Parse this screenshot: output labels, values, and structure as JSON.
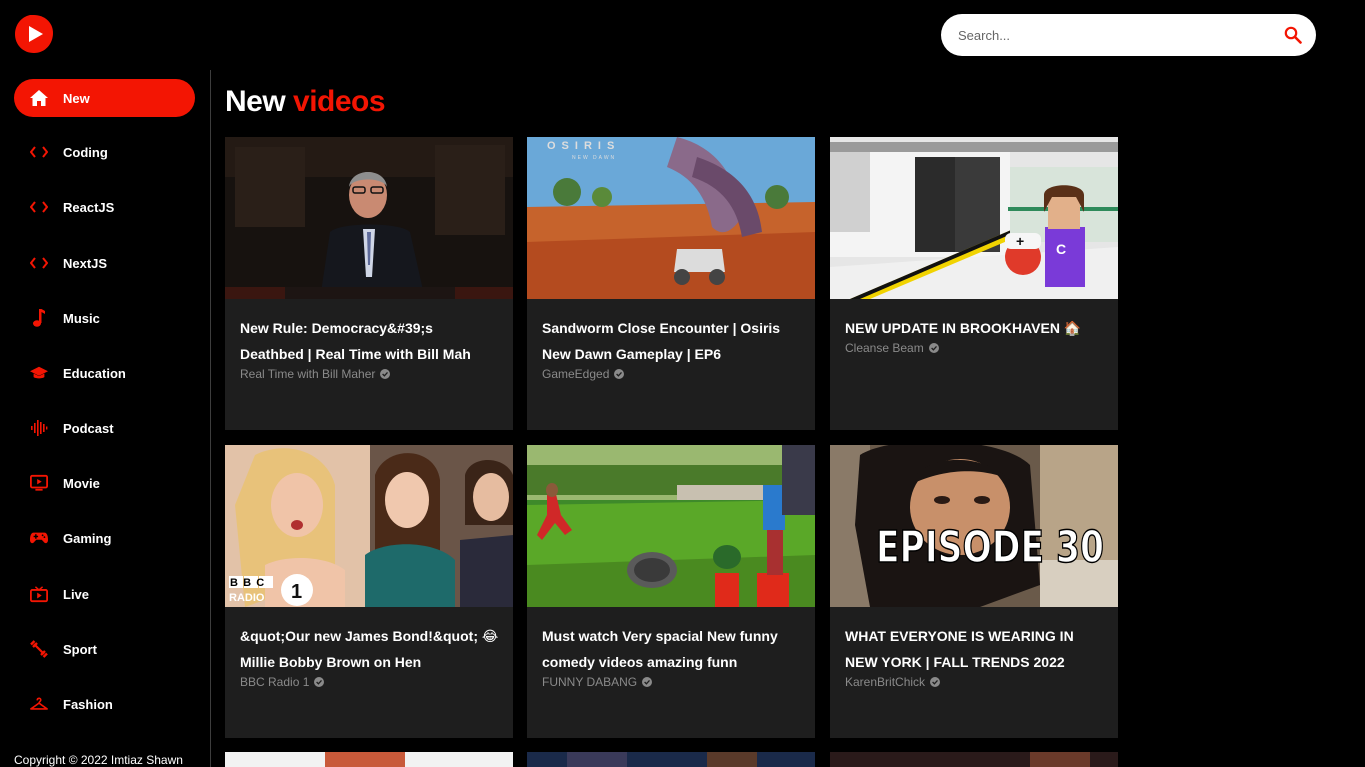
{
  "brand": {
    "accent": "#f31503"
  },
  "search": {
    "placeholder": "Search..."
  },
  "sidebar": {
    "items": [
      {
        "label": "New",
        "icon": "home-icon",
        "active": true
      },
      {
        "label": "Coding",
        "icon": "code-icon"
      },
      {
        "label": "ReactJS",
        "icon": "code-icon"
      },
      {
        "label": "NextJS",
        "icon": "code-icon"
      },
      {
        "label": "Music",
        "icon": "music-note-icon"
      },
      {
        "label": "Education",
        "icon": "graduation-cap-icon"
      },
      {
        "label": "Podcast",
        "icon": "podcast-waveform-icon"
      },
      {
        "label": "Movie",
        "icon": "tv-play-icon"
      },
      {
        "label": "Gaming",
        "icon": "gamepad-icon"
      },
      {
        "label": "Live",
        "icon": "live-tv-icon"
      },
      {
        "label": "Sport",
        "icon": "fitness-icon"
      },
      {
        "label": "Fashion",
        "icon": "hanger-icon"
      }
    ],
    "copyright": "Copyright © 2022 Imtiaz Shawn"
  },
  "main": {
    "title_prefix": "New",
    "title_accent": "videos",
    "videos": [
      {
        "title": "New Rule: Democracy&#39;s Deathbed | Real Time with Bill Mah",
        "channel": "Real Time with Bill Maher"
      },
      {
        "title": "Sandworm Close Encounter | Osiris New Dawn Gameplay | EP6",
        "channel": "GameEdged"
      },
      {
        "title": "NEW UPDATE IN BROOKHAVEN 🏠 RP!",
        "channel": "Cleanse Beam"
      },
      {
        "title": "&quot;Our new James Bond!&quot; 😂 Millie Bobby Brown on Hen",
        "channel": "BBC Radio 1"
      },
      {
        "title": "Must watch Very spacial New funny comedy videos amazing funn",
        "channel": "FUNNY DABANG"
      },
      {
        "title": "WHAT EVERYONE IS WEARING IN NEW YORK | FALL TRENDS 2022",
        "channel": "KarenBritChick"
      }
    ],
    "thumb_texts": {
      "osiris": "OSIRIS",
      "osiris_sub": "NEW DAWN",
      "bbc": "BBC",
      "radio": "RADIO",
      "one": "1",
      "episode": "EPISODE 30"
    }
  }
}
